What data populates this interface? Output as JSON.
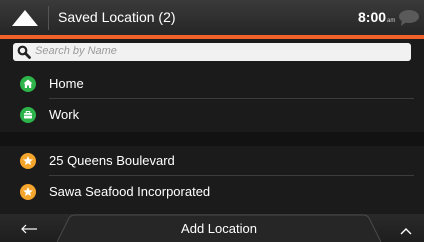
{
  "header": {
    "title": "Saved Location (2)",
    "time": "8:00",
    "ampm": "am",
    "back_icon": "back-triangle-icon",
    "message_icon": "message-bubble-icon",
    "accent_color": "#f0622a"
  },
  "search": {
    "placeholder": "Search by Name",
    "icon": "search-icon"
  },
  "groups": [
    {
      "items": [
        {
          "label": "Home",
          "icon": "home-icon",
          "icon_color": "#2db34a"
        },
        {
          "label": "Work",
          "icon": "briefcase-icon",
          "icon_color": "#2db34a"
        }
      ]
    },
    {
      "items": [
        {
          "label": "25 Queens Boulevard",
          "icon": "star-icon",
          "icon_color": "#f4a52c"
        },
        {
          "label": "Sawa Seafood Incorporated",
          "icon": "star-icon",
          "icon_color": "#f4a52c"
        }
      ]
    }
  ],
  "footer": {
    "back_icon": "arrow-left-icon",
    "action_label": "Add Location",
    "expand_icon": "chevron-up-icon"
  }
}
